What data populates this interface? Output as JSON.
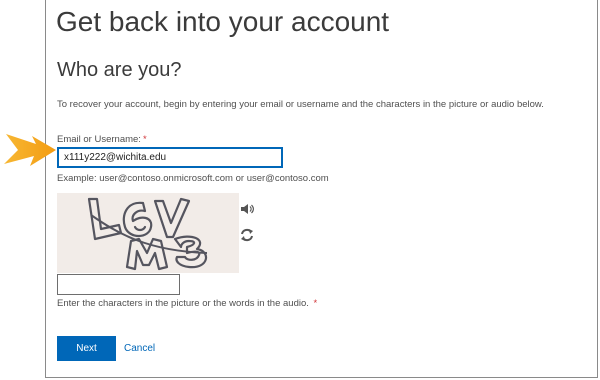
{
  "page": {
    "title": "Get back into your account",
    "subtitle": "Who are you?",
    "instructions": "To recover your account, begin by entering your email or username and the characters in the picture or audio below."
  },
  "email_field": {
    "label": "Email or Username:",
    "required_mark": "*",
    "value": "x111y222@wichita.edu",
    "example": "Example: user@contoso.onmicrosoft.com or user@contoso.com"
  },
  "captcha": {
    "image_text": "L6VM3",
    "audio_icon": "speaker-icon",
    "refresh_icon": "refresh-icon",
    "input_value": "",
    "instruction": "Enter the characters in the picture or the words in the audio.",
    "required_mark": "*"
  },
  "actions": {
    "next_label": "Next",
    "cancel_label": "Cancel"
  },
  "annotation": {
    "icon": "arrow-pointer-icon",
    "color": "#f5a623"
  },
  "colors": {
    "accent": "#0067b8",
    "required": "#d13438"
  }
}
